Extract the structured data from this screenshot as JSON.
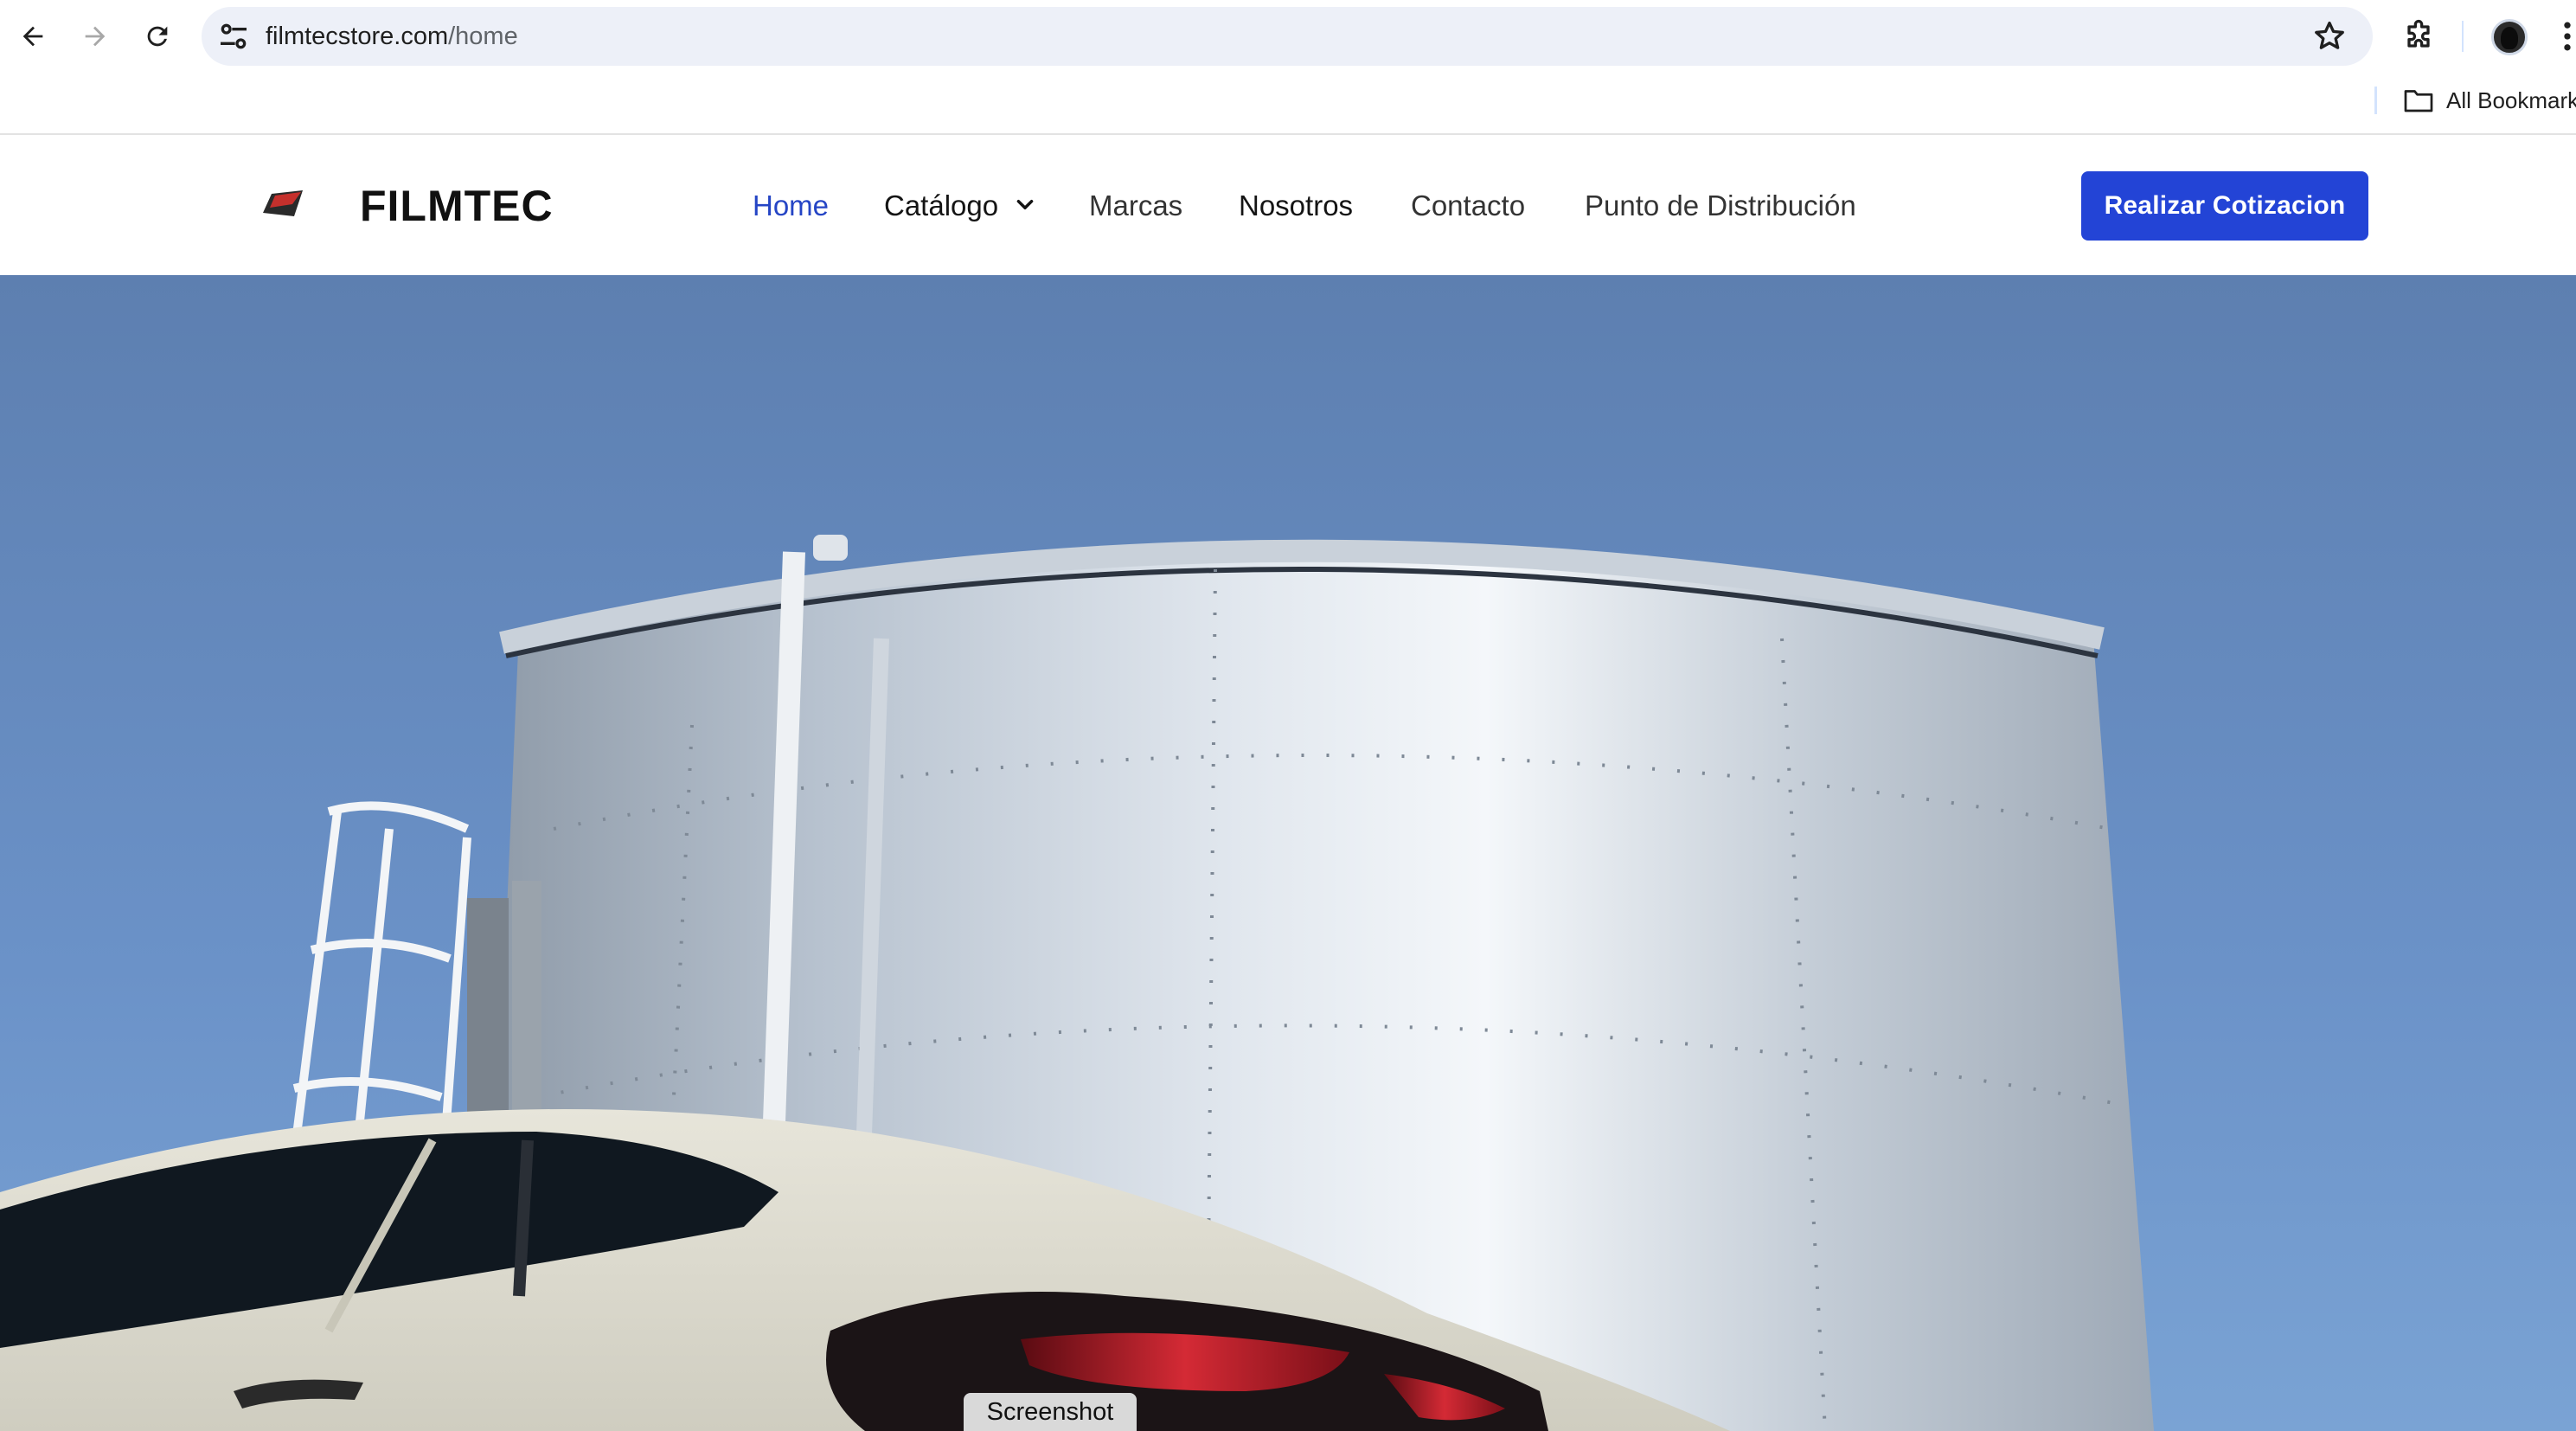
{
  "browser": {
    "url_host": "filmtecstore.com",
    "url_path": "/home",
    "bookmarks_label": "All Bookmark",
    "icons": {
      "back": "arrow-left-icon",
      "forward": "arrow-right-icon",
      "reload": "reload-icon",
      "site_info": "tune-icon",
      "bookmark": "star-icon",
      "extensions": "puzzle-icon",
      "menu": "kebab-menu-icon",
      "folder": "folder-icon"
    }
  },
  "site": {
    "brand": "FILMTEC",
    "nav": [
      {
        "label": "Home",
        "active": true
      },
      {
        "label": "Catálogo",
        "has_dropdown": true
      },
      {
        "label": "Marcas"
      },
      {
        "label": "Nosotros"
      },
      {
        "label": "Contacto"
      },
      {
        "label": "Punto de Distribución"
      }
    ],
    "cta_label": "Realizar Cotizacion",
    "colors": {
      "accent": "#2344d6",
      "active_link": "#2545c5",
      "logo_red": "#c5302c"
    }
  },
  "hero": {
    "image_alt": "Steel water tank under blue sky with white car in foreground"
  },
  "overlay": {
    "label": "Screenshot"
  }
}
